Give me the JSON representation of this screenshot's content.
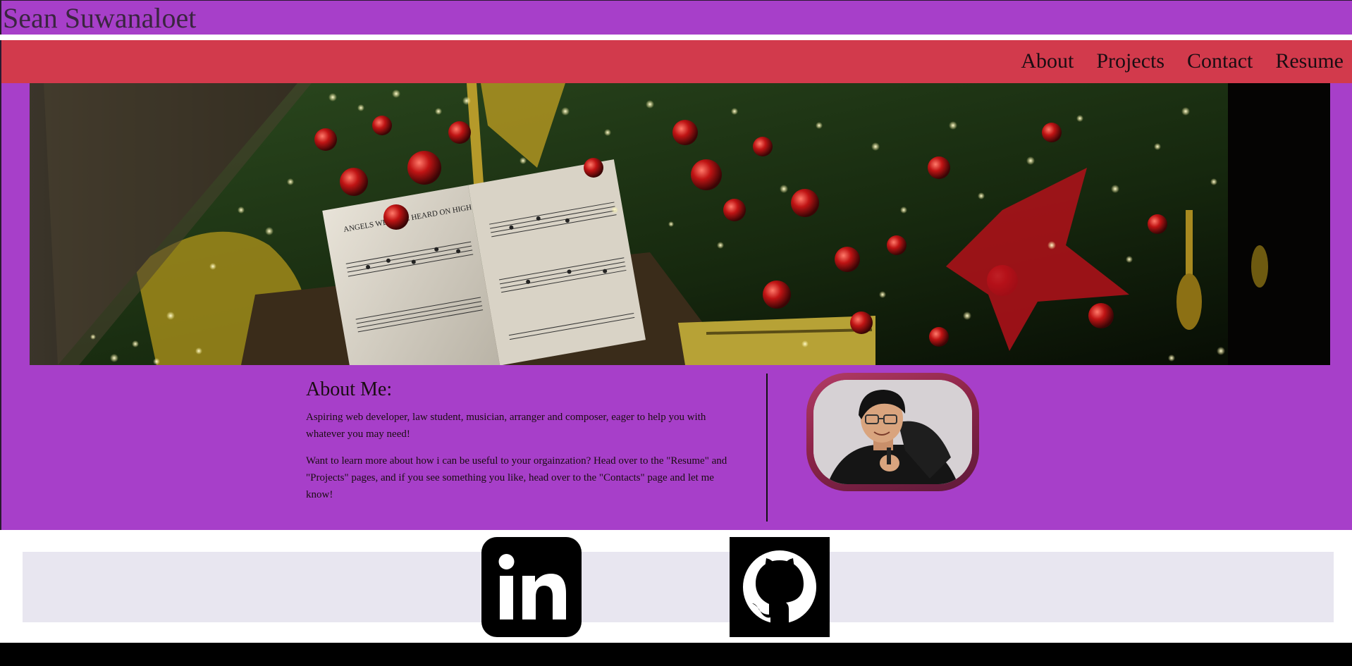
{
  "header": {
    "site_title": "Sean Suwanaloet"
  },
  "nav": {
    "items": [
      {
        "label": "About"
      },
      {
        "label": "Projects"
      },
      {
        "label": "Contact"
      },
      {
        "label": "Resume"
      }
    ]
  },
  "hero": {
    "sheet_music_title": "ANGELS WE HAVE HEARD ON HIGH"
  },
  "about": {
    "heading": "About Me:",
    "paragraph_1": "Aspiring web developer, law student, musician, arranger and composer, eager to help you with whatever you may need!",
    "paragraph_2": "Want to learn more about how i can be useful to your orgainzation? Head over to the \"Resume\" and \"Projects\" pages, and if you see something you like, head over to the \"Contacts\" page and let me know!"
  },
  "social": {
    "links": [
      {
        "name": "LinkedIn",
        "icon": "linkedin-icon"
      },
      {
        "name": "GitHub",
        "icon": "github-icon"
      }
    ]
  },
  "colors": {
    "purple": "#a73fc9",
    "nav_red": "#d23a4c",
    "frame": "#8c2448",
    "social_band": "#e8e6f0",
    "footer": "#000000"
  }
}
